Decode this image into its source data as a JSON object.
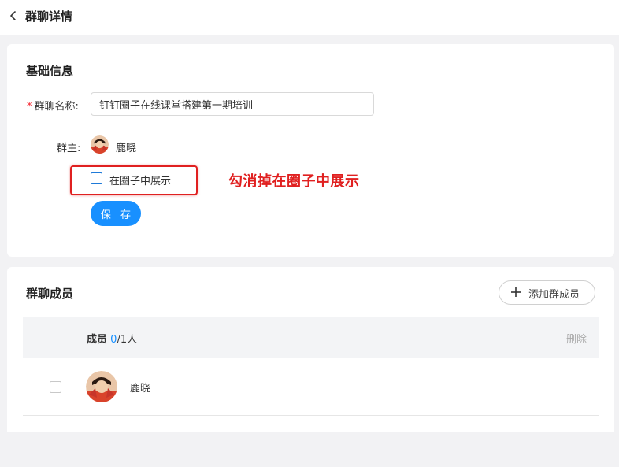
{
  "header": {
    "back_icon": "chevron-left-icon",
    "title": "群聊详情"
  },
  "basic_info": {
    "section_title": "基础信息",
    "name_label": "群聊名称:",
    "required_mark": "*",
    "name_value": "钉钉圈子在线课堂搭建第一期培训",
    "owner_label": "群主:",
    "owner_name": "鹿晓",
    "show_in_circle_label": "在圈子中展示",
    "show_in_circle_checked": false,
    "annotation": "勾消掉在圈子中展示",
    "save_label": "保 存"
  },
  "members": {
    "section_title": "群聊成员",
    "add_button_label": "添加群成员",
    "header_label": "成员",
    "selected_count": "0",
    "total_text": "/1人",
    "delete_label": "删除",
    "rows": [
      {
        "name": "鹿晓",
        "checked": false
      }
    ]
  },
  "colors": {
    "accent": "#1890ff",
    "annotation_red": "#e02020",
    "background": "#f2f2f4"
  }
}
